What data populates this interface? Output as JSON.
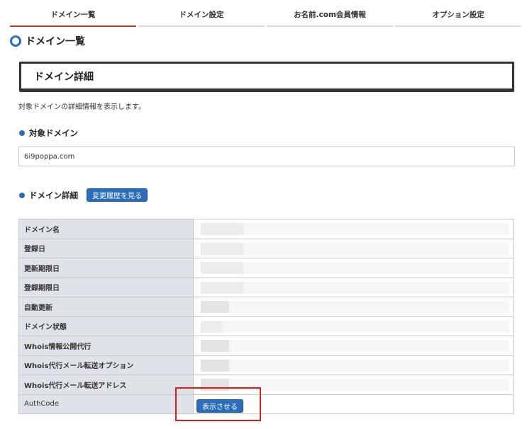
{
  "tabs": [
    {
      "label": "ドメイン一覧",
      "active": true
    },
    {
      "label": "ドメイン設定",
      "active": false
    },
    {
      "label": "お名前.com会員情報",
      "active": false
    },
    {
      "label": "オプション設定",
      "active": false
    }
  ],
  "page_title": "ドメイン一覧",
  "panel_heading": "ドメイン詳細",
  "description": "対象ドメインの詳細情報を表示します。",
  "target_domain": {
    "label": "対象ドメイン",
    "value": "6i9poppa.com"
  },
  "domain_details": {
    "label": "ドメイン詳細",
    "history_button": "変更履歴を見る",
    "rows": [
      {
        "label": "ドメイン名"
      },
      {
        "label": "登録日"
      },
      {
        "label": "更新期限日"
      },
      {
        "label": "登録期限日"
      },
      {
        "label": "自動更新"
      },
      {
        "label": "ドメイン状態"
      },
      {
        "label": "Whois情報公開代行"
      },
      {
        "label": "Whois代行メール転送オプション"
      },
      {
        "label": "Whois代行メール転送アドレス"
      },
      {
        "label": "AuthCode"
      }
    ],
    "authcode_button": "表示させる"
  },
  "colors": {
    "accent": "#2a6ebb",
    "active_tab_underline": "#c0392b",
    "highlight_box": "#e01b1b",
    "row_header_bg": "#dfe3e9"
  }
}
